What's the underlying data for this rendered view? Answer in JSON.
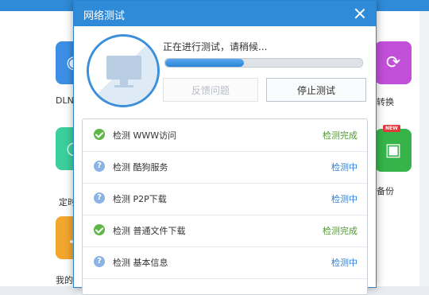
{
  "dialog": {
    "title": "网络测试",
    "status_text": "正在进行测试，请稍候...",
    "progress": 0.4,
    "feedback_label": "反馈问题",
    "stop_label": "停止测试"
  },
  "tests": [
    {
      "label": "检测  WWW访问",
      "state": "检测完成",
      "done": true
    },
    {
      "label": "检测  酷狗服务",
      "state": "检测中",
      "done": false
    },
    {
      "label": "检测  P2P下载",
      "state": "检测中",
      "done": false
    },
    {
      "label": "检测  普通文件下载",
      "state": "检测完成",
      "done": true
    },
    {
      "label": "检测  基本信息",
      "state": "检测中",
      "done": false
    }
  ],
  "background": {
    "tiles": [
      {
        "label": "DLN",
        "color": "#3d8fe6",
        "icon": "dlna-icon"
      },
      {
        "label": "定时",
        "color": "#3ccf9c",
        "icon": "timer-icon"
      },
      {
        "label": "我的",
        "color": "#f2a62e",
        "icon": "music-icon"
      },
      {
        "label": "转换",
        "color": "#c24fd8",
        "icon": "convert-icon"
      },
      {
        "label": "备份",
        "color": "#36b44a",
        "icon": "backup-icon"
      }
    ],
    "new_badge": "NEW"
  },
  "colors": {
    "accent": "#2f8ad8",
    "success": "#4f9a2c",
    "running": "#2f80d4"
  }
}
